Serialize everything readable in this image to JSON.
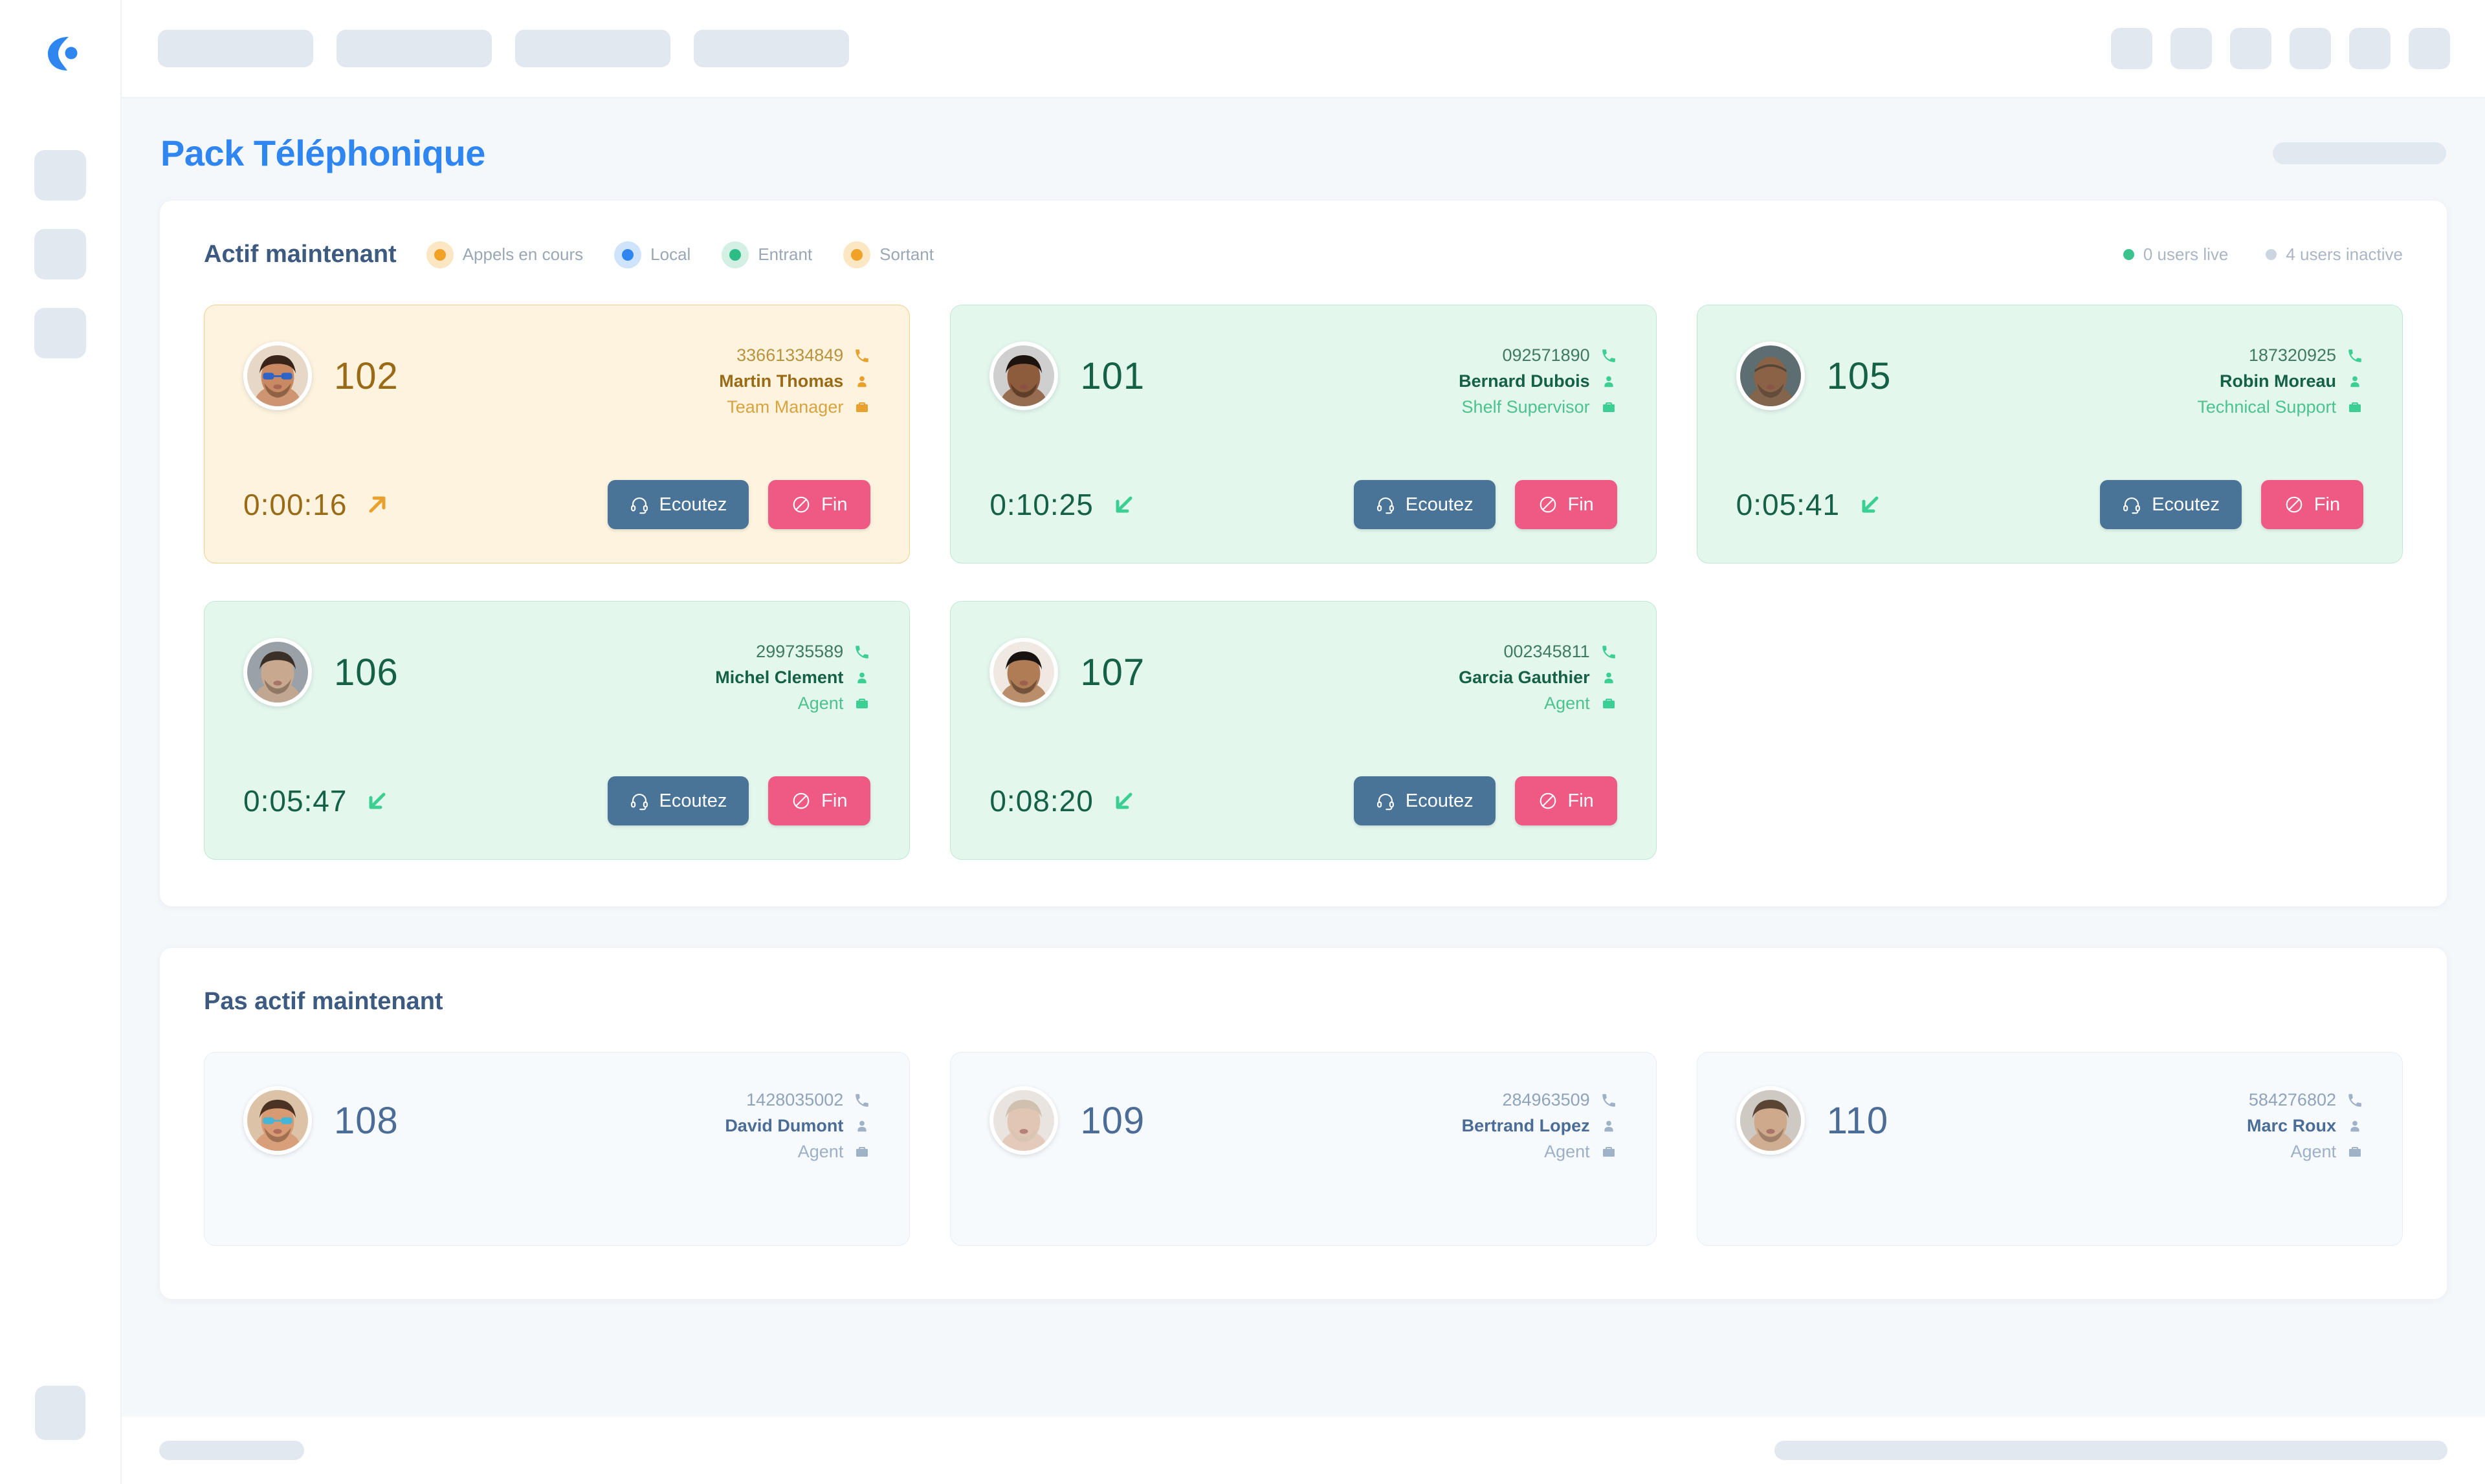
{
  "brand": {
    "logo_icon": "crisp-c-logo"
  },
  "sidebar": {
    "items": [
      {
        "name": "nav-skeleton-1"
      },
      {
        "name": "nav-skeleton-2"
      },
      {
        "name": "nav-skeleton-3"
      }
    ],
    "bottom_item": {
      "name": "nav-skeleton-bottom"
    }
  },
  "topbar": {
    "tabs": [
      {
        "name": "tab-skeleton-1"
      },
      {
        "name": "tab-skeleton-2"
      },
      {
        "name": "tab-skeleton-3"
      },
      {
        "name": "tab-skeleton-4"
      }
    ],
    "icons": [
      {
        "name": "icon-skeleton-1"
      },
      {
        "name": "icon-skeleton-2"
      },
      {
        "name": "icon-skeleton-3"
      },
      {
        "name": "icon-skeleton-4"
      },
      {
        "name": "icon-skeleton-5"
      },
      {
        "name": "icon-skeleton-6"
      }
    ]
  },
  "page": {
    "title": "Pack Téléphonique",
    "title_color": "#2f86f0"
  },
  "active_section": {
    "title": "Actif maintenant",
    "legend": [
      {
        "label": "Appels en cours",
        "color": "#f0a126",
        "halo": "#fbe7c4"
      },
      {
        "label": "Local",
        "color": "#2f86f0",
        "halo": "#cfe3fb"
      },
      {
        "label": "Entrant",
        "color": "#2bbd86",
        "halo": "#d4f0e4"
      },
      {
        "label": "Sortant",
        "color": "#f0a126",
        "halo": "#fbe7c4"
      }
    ],
    "stats": [
      {
        "label": "0 users live",
        "color": "#3ac48c"
      },
      {
        "label": "4 users inactive",
        "color": "#ccd6e0"
      }
    ],
    "buttons": {
      "listen": "Ecoutez",
      "end": "Fin"
    },
    "cards": [
      {
        "extension": "102",
        "phone": "33661334849",
        "name": "Martin Thomas",
        "role": "Team Manager",
        "timer": "0:00:16",
        "direction": "outgoing",
        "avatar": "man-sunglasses",
        "listen_label": "Ecoutez",
        "end_label": "Fin"
      },
      {
        "extension": "101",
        "phone": "092571890",
        "name": "Bernard Dubois",
        "role": "Shelf Supervisor",
        "timer": "0:10:25",
        "direction": "incoming",
        "avatar": "young-man-curly",
        "listen_label": "Ecoutez",
        "end_label": "Fin"
      },
      {
        "extension": "105",
        "phone": "187320925",
        "name": "Robin Moreau",
        "role": "Technical  Support",
        "timer": "0:05:41",
        "direction": "incoming",
        "avatar": "bald-bearded-man",
        "listen_label": "Ecoutez",
        "end_label": "Fin"
      },
      {
        "extension": "106",
        "phone": "299735589",
        "name": "Michel Clement",
        "role": "Agent",
        "timer": "0:05:47",
        "direction": "incoming",
        "avatar": "young-man-grey",
        "listen_label": "Ecoutez",
        "end_label": "Fin"
      },
      {
        "extension": "107",
        "phone": "002345811",
        "name": "Garcia Gauthier",
        "role": "Agent",
        "timer": "0:08:20",
        "direction": "incoming",
        "avatar": "bearded-man-dark",
        "listen_label": "Ecoutez",
        "end_label": "Fin"
      }
    ]
  },
  "inactive_section": {
    "title": "Pas actif maintenant",
    "cards": [
      {
        "extension": "108",
        "phone": "1428035002",
        "name": "David Dumont",
        "role": "Agent",
        "avatar": "teen-sunglasses"
      },
      {
        "extension": "109",
        "phone": "284963509",
        "name": "Bertrand Lopez",
        "role": "Agent",
        "avatar": "pale-man"
      },
      {
        "extension": "110",
        "phone": "584276802",
        "name": "Marc Roux",
        "role": "Agent",
        "avatar": "bearded-man-light"
      }
    ]
  },
  "footer": {
    "left_skeleton": {
      "name": "footer-skeleton-left"
    },
    "right_skeleton": {
      "name": "footer-skeleton-right"
    }
  }
}
